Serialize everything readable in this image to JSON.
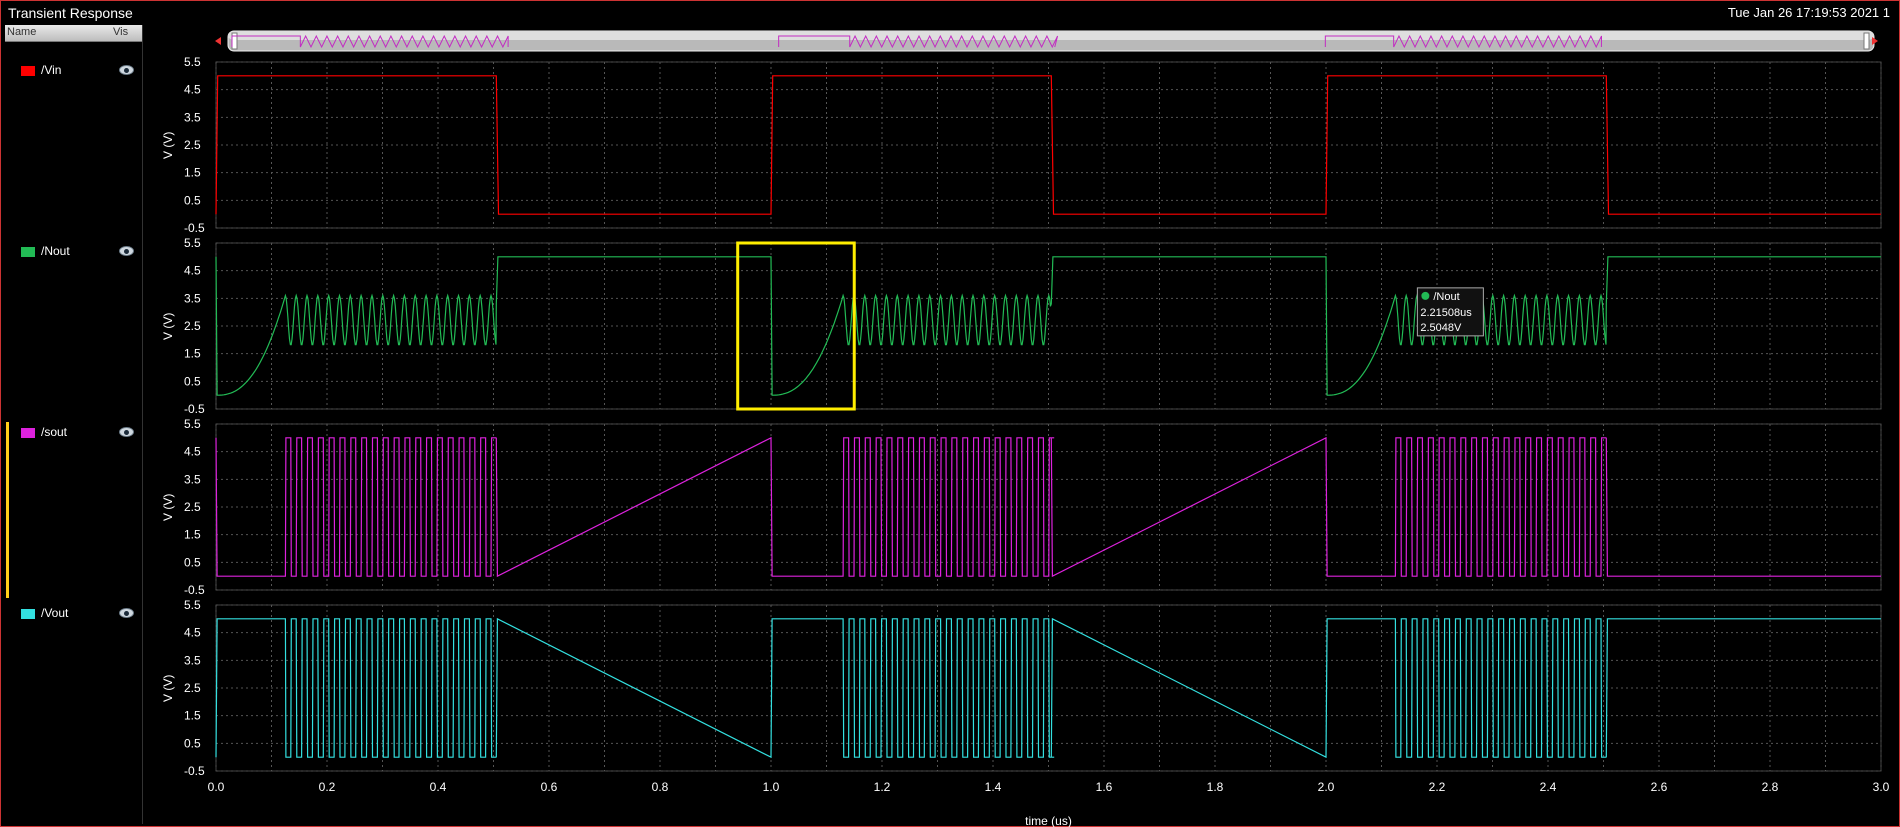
{
  "window": {
    "title": "Transient Response",
    "datestamp": "Tue Jan 26 17:19:53 2021  1"
  },
  "legend": {
    "col_name": "Name",
    "col_vis": "Vis",
    "items": [
      {
        "label": "/Vin",
        "color": "#ff0000"
      },
      {
        "label": "/Nout",
        "color": "#22bb55"
      },
      {
        "label": "/sout",
        "color": "#dd22dd"
      },
      {
        "label": "/Vout",
        "color": "#33e0e0"
      }
    ]
  },
  "marker": {
    "trace": "/Nout",
    "time_label": "2.21508us",
    "value_label": "2.5048V",
    "time": 2.21508,
    "value": 2.5048
  },
  "chart_data": {
    "type": "line",
    "xlabel": "time (us)",
    "xlim": [
      0,
      3.0
    ],
    "xticks": [
      "0.0",
      "0.2",
      "0.4",
      "0.6",
      "0.8",
      "1.0",
      "1.2",
      "1.4",
      "1.6",
      "1.8",
      "2.0",
      "2.2",
      "2.4",
      "2.6",
      "2.8",
      "3.0"
    ],
    "grid": true,
    "highlight_box_color": "#ffee00",
    "highlight_box_x": [
      0.94,
      1.15
    ],
    "highlight_box_y": [
      -0.5,
      5.5
    ],
    "panels": [
      {
        "ylabel": "V (V)",
        "ylim": [
          -0.5,
          5.5
        ],
        "yticks": [
          "5.5",
          "4.5",
          "3.5",
          "2.5",
          "1.5",
          "0.5",
          "-0.5"
        ],
        "series": [
          {
            "name": "/Vin",
            "color": "#ff0000",
            "shape": "square",
            "high": 5.0,
            "low": 0.0,
            "high_intervals": [
              [
                0.0,
                0.505
              ],
              [
                1.0,
                1.505
              ],
              [
                2.0,
                2.505
              ]
            ]
          }
        ]
      },
      {
        "ylabel": "V (V)",
        "ylim": [
          -0.5,
          5.5
        ],
        "yticks": [
          "5.5",
          "4.5",
          "3.5",
          "2.5",
          "1.5",
          "0.5",
          "-0.5"
        ],
        "series": [
          {
            "name": "/Nout",
            "color": "#22bb55",
            "shape": "ramp_oscillate",
            "high": 5.0,
            "low": 0.0,
            "osc_min": 1.8,
            "osc_max": 3.6,
            "osc_period": 0.0195,
            "bursts": [
              [
                0.0,
                0.125,
                0.505
              ],
              [
                1.0,
                1.13,
                1.505
              ],
              [
                2.0,
                2.125,
                2.505
              ]
            ]
          }
        ]
      },
      {
        "ylabel": "V (V)",
        "ylim": [
          -0.5,
          5.5
        ],
        "yticks": [
          "5.5",
          "4.5",
          "3.5",
          "2.5",
          "1.5",
          "0.5",
          "-0.5"
        ],
        "series": [
          {
            "name": "/sout",
            "color": "#dd22dd",
            "shape": "pulse_train",
            "high": 5.0,
            "low": 0.0,
            "period": 0.0195,
            "bursts": [
              [
                0.0,
                0.125,
                0.505
              ],
              [
                1.0,
                1.13,
                1.505
              ],
              [
                2.0,
                2.125,
                2.505
              ]
            ],
            "idle_level": "high"
          }
        ]
      },
      {
        "ylabel": "V (V)",
        "ylim": [
          -0.5,
          5.5
        ],
        "yticks": [
          "5.5",
          "4.5",
          "3.5",
          "2.5",
          "1.5",
          "0.5",
          "-0.5"
        ],
        "series": [
          {
            "name": "/Vout",
            "color": "#33e0e0",
            "shape": "pulse_train",
            "high": 5.0,
            "low": 0.0,
            "period": 0.0195,
            "bursts": [
              [
                0.0,
                0.125,
                0.505
              ],
              [
                1.0,
                1.13,
                1.505
              ],
              [
                2.0,
                2.125,
                2.505
              ]
            ],
            "idle_level": "low"
          }
        ]
      }
    ]
  }
}
